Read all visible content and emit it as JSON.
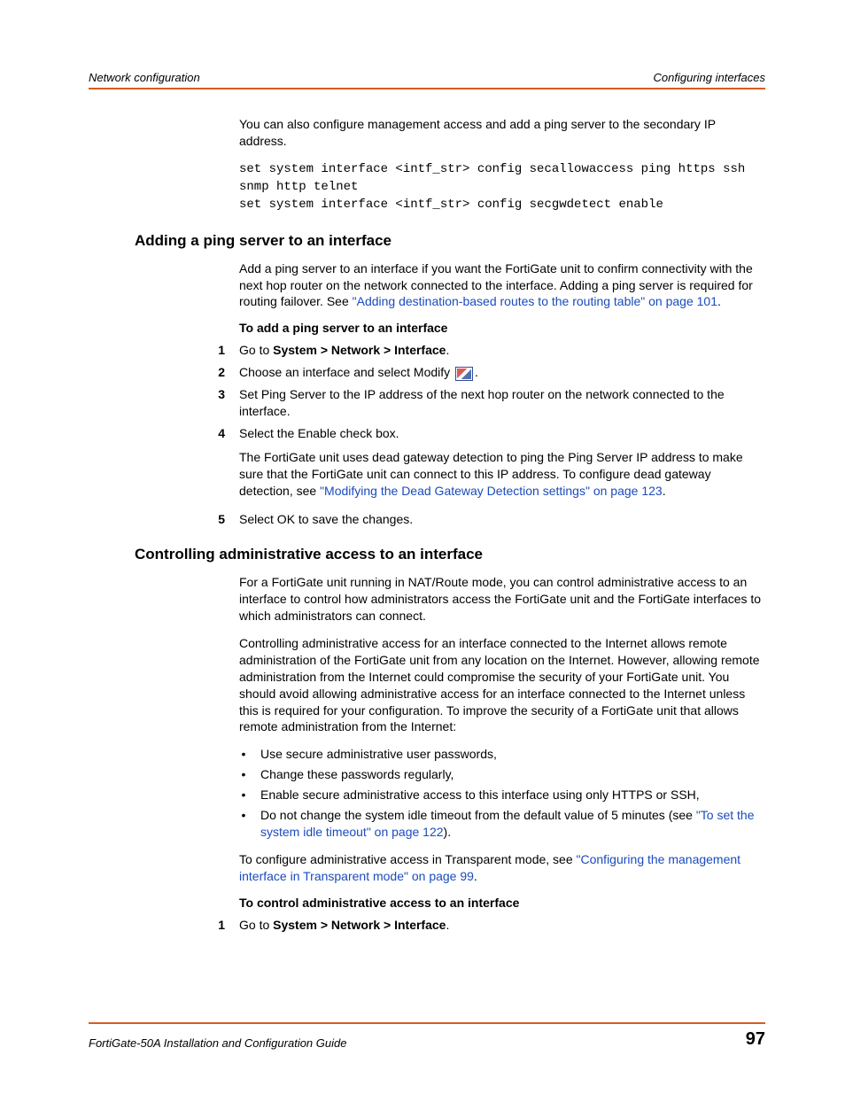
{
  "header": {
    "left": "Network configuration",
    "right": "Configuring interfaces"
  },
  "intro": {
    "para": "You can also configure management access and add a ping server to the secondary IP address.",
    "code": "set system interface <intf_str> config secallowaccess ping https ssh snmp http telnet\nset system interface <intf_str> config secgwdetect enable"
  },
  "s1": {
    "heading": "Adding a ping server to an interface",
    "lead_a": "Add a ping server to an interface if you want the FortiGate unit to confirm connectivity with the next hop router on the network connected to the interface. Adding a ping server is required for routing failover. See ",
    "lead_link": "\"Adding destination-based routes to the routing table\" on page 101",
    "lead_b": ".",
    "sub": "To add a ping server to an interface",
    "step1_a": "Go to ",
    "step1_b": "System > Network > Interface",
    "step1_c": ".",
    "step2": "Choose an interface and select Modify ",
    "step2_end": ".",
    "step3": "Set Ping Server to the IP address of the next hop router on the network connected to the interface.",
    "step4a": "Select the Enable check box.",
    "step4b_a": "The FortiGate unit uses dead gateway detection to ping the Ping Server IP address to make sure that the FortiGate unit can connect to this IP address. To configure dead gateway detection, see ",
    "step4b_link": "\"Modifying the Dead Gateway Detection settings\" on page 123",
    "step4b_b": ".",
    "step5": "Select OK to save the changes."
  },
  "s2": {
    "heading": "Controlling administrative access to an interface",
    "p1": "For a FortiGate unit running in NAT/Route mode, you can control administrative access to an interface to control how administrators access the FortiGate unit and the FortiGate interfaces to which administrators can connect.",
    "p2": "Controlling administrative access for an interface connected to the Internet allows remote administration of the FortiGate unit from any location on the Internet. However, allowing remote administration from the Internet could compromise the security of your FortiGate unit. You should avoid allowing administrative access for an interface connected to the Internet unless this is required for your configuration. To improve the security of a FortiGate unit that allows remote administration from the Internet:",
    "b1": "Use secure administrative user passwords,",
    "b2": "Change these passwords regularly,",
    "b3": "Enable secure administrative access to this interface using only HTTPS or SSH,",
    "b4_a": "Do not change the system idle timeout from the default value of 5 minutes (see ",
    "b4_link": "\"To set the system idle timeout\" on page 122",
    "b4_b": ").",
    "p3_a": "To configure administrative access in Transparent mode, see ",
    "p3_link": "\"Configuring the management interface in Transparent mode\" on page 99",
    "p3_b": ".",
    "sub": "To control administrative access to an interface",
    "step1_a": "Go to ",
    "step1_b": "System > Network > Interface",
    "step1_c": "."
  },
  "footer": {
    "title": "FortiGate-50A Installation and Configuration Guide",
    "page": "97"
  },
  "nums": {
    "n1": "1",
    "n2": "2",
    "n3": "3",
    "n4": "4",
    "n5": "5"
  }
}
